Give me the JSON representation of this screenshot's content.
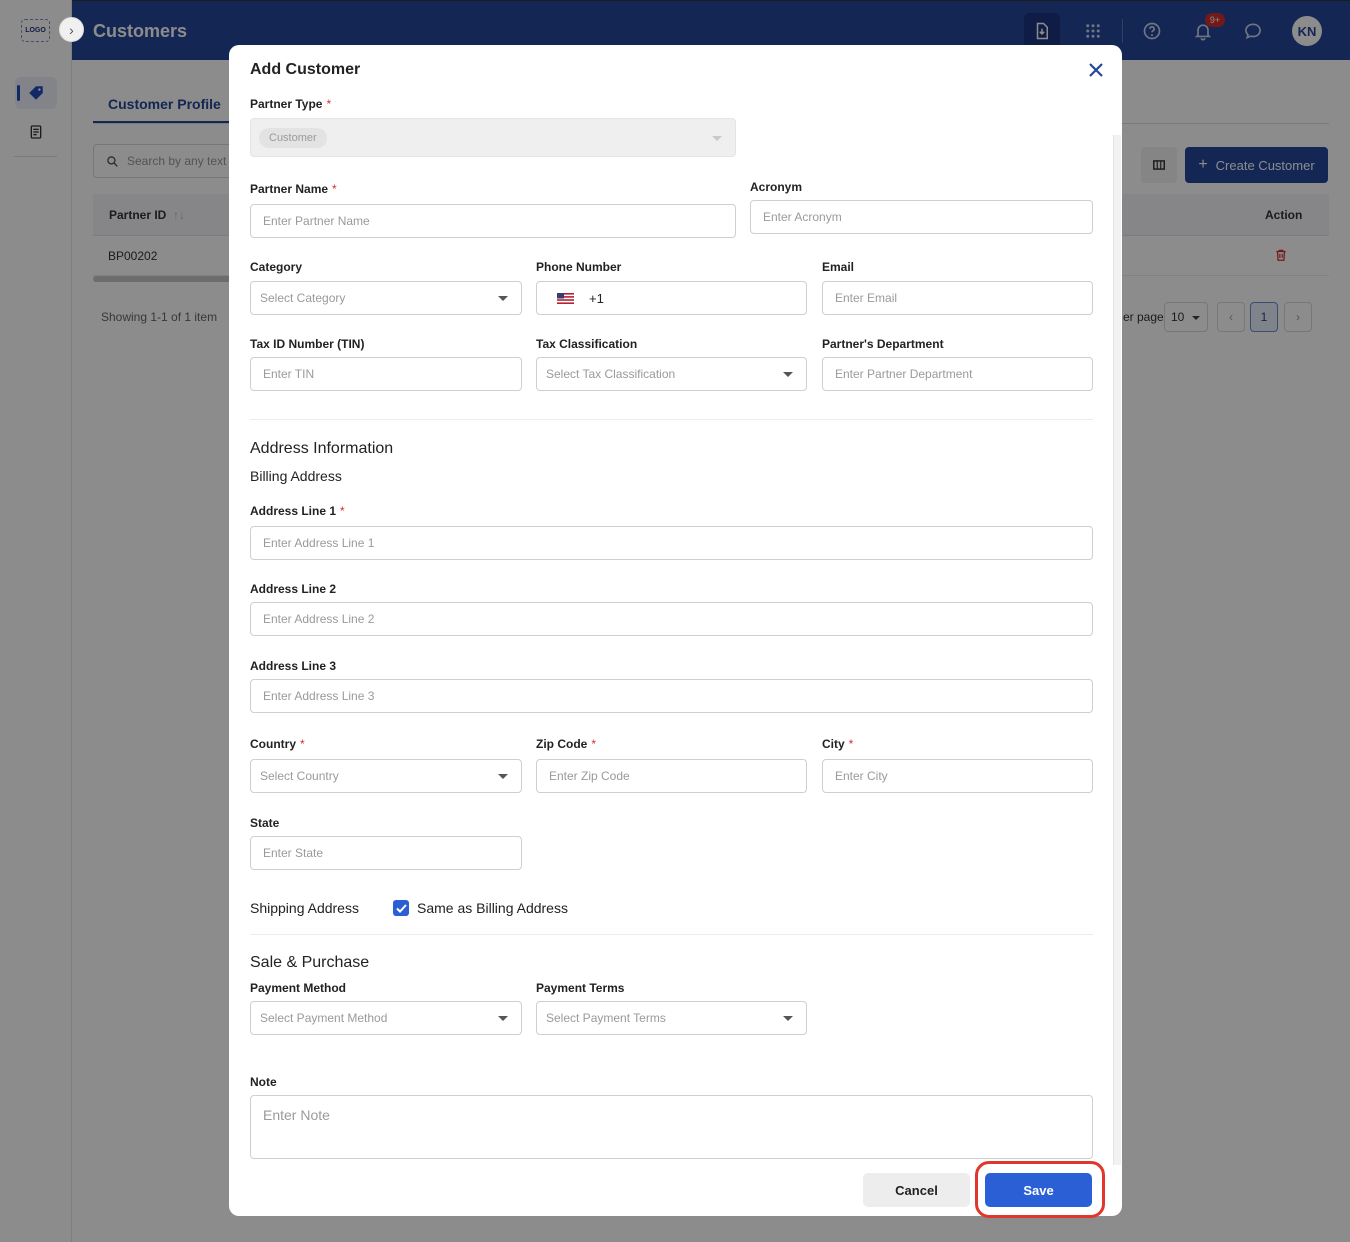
{
  "app": {
    "logo_text": "LOGO",
    "page_title": "Customers",
    "notification_count": "9+",
    "avatar_initials": "KN"
  },
  "background": {
    "tab_label": "Customer Profile",
    "search_placeholder": "Search by any text",
    "create_button": "Create Customer",
    "table": {
      "headers": [
        "Partner ID",
        "Action"
      ],
      "rows": [
        {
          "partner_id": "BP00202"
        }
      ]
    },
    "showing_text": "Showing 1-1 of 1 item",
    "per_page_label": "er page",
    "per_page_value": "10",
    "current_page": "1"
  },
  "modal": {
    "title": "Add Customer",
    "partner_type": {
      "label": "Partner Type",
      "required": "*",
      "value": "Customer"
    },
    "partner_name": {
      "label": "Partner Name",
      "required": "*",
      "placeholder": "Enter Partner Name"
    },
    "acronym": {
      "label": "Acronym",
      "placeholder": "Enter Acronym"
    },
    "category": {
      "label": "Category",
      "placeholder": "Select Category"
    },
    "phone": {
      "label": "Phone Number",
      "code": "+1"
    },
    "email": {
      "label": "Email",
      "placeholder": "Enter Email"
    },
    "tin": {
      "label": "Tax ID Number (TIN)",
      "placeholder": "Enter TIN"
    },
    "tax_class": {
      "label": "Tax Classification",
      "placeholder": "Select Tax Classification"
    },
    "department": {
      "label": "Partner's Department",
      "placeholder": "Enter Partner Department"
    },
    "address_section": "Address Information",
    "billing_title": "Billing Address",
    "addr1": {
      "label": "Address Line 1",
      "required": "*",
      "placeholder": "Enter Address Line 1"
    },
    "addr2": {
      "label": "Address Line 2",
      "placeholder": "Enter Address Line 2"
    },
    "addr3": {
      "label": "Address Line 3",
      "placeholder": "Enter Address Line 3"
    },
    "country": {
      "label": "Country",
      "required": "*",
      "placeholder": "Select Country"
    },
    "zip": {
      "label": "Zip Code",
      "required": "*",
      "placeholder": "Enter Zip Code"
    },
    "city": {
      "label": "City",
      "required": "*",
      "placeholder": "Enter City"
    },
    "state": {
      "label": "State",
      "placeholder": "Enter State"
    },
    "shipping_title": "Shipping Address",
    "same_as_billing": {
      "label": "Same as Billing Address",
      "checked": true
    },
    "sale_section": "Sale & Purchase",
    "payment_method": {
      "label": "Payment Method",
      "placeholder": "Select Payment Method"
    },
    "payment_terms": {
      "label": "Payment Terms",
      "placeholder": "Select Payment Terms"
    },
    "note": {
      "label": "Note",
      "placeholder": "Enter Note"
    },
    "cancel_label": "Cancel",
    "save_label": "Save"
  },
  "colors": {
    "brand": "#23459a",
    "primary_button": "#2a5fd6",
    "required": "#d32f2f",
    "highlight": "#e0362c"
  }
}
